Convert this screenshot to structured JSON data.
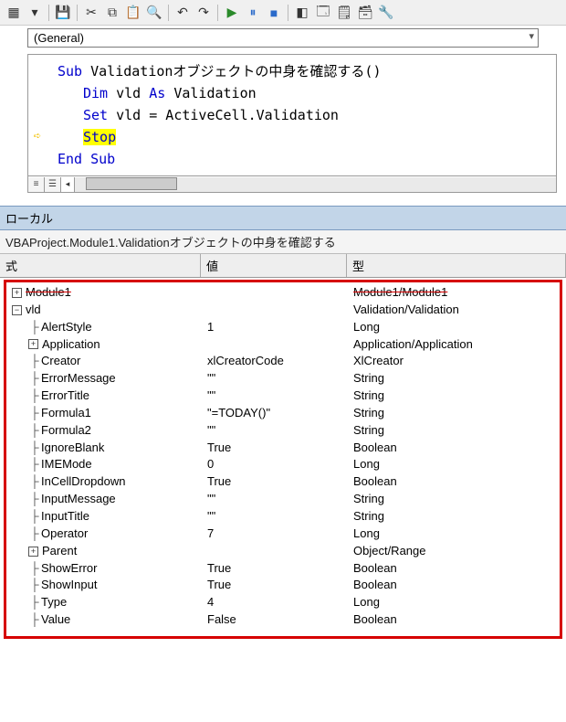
{
  "dropdown": {
    "value": "(General)"
  },
  "code": {
    "line1_prefix": "Sub",
    "line1_name": " Validationオブジェクトの中身を確認する()",
    "line2_dim": "Dim",
    "line2_var": " vld ",
    "line2_as": "As",
    "line2_type": " Validation",
    "line3_set": "Set",
    "line3_rest": " vld = ActiveCell.Validation",
    "line4_stop": "Stop",
    "line5": "End Sub"
  },
  "locals": {
    "title": "ローカル",
    "context": "VBAProject.Module1.Validationオブジェクトの中身を確認する",
    "headers": {
      "expr": "式",
      "val": "値",
      "type": "型"
    },
    "root1": {
      "name": "Module1",
      "type": "Module1/Module1"
    },
    "root2": {
      "name": "vld",
      "type": "Validation/Validation"
    },
    "props": [
      {
        "name": "AlertStyle",
        "val": "1",
        "type": "Long",
        "icon": "leaf"
      },
      {
        "name": "Application",
        "val": "",
        "type": "Application/Application",
        "icon": "plus"
      },
      {
        "name": "Creator",
        "val": "xlCreatorCode",
        "type": "XlCreator",
        "icon": "leaf"
      },
      {
        "name": "ErrorMessage",
        "val": "\"\"",
        "type": "String",
        "icon": "leaf"
      },
      {
        "name": "ErrorTitle",
        "val": "\"\"",
        "type": "String",
        "icon": "leaf"
      },
      {
        "name": "Formula1",
        "val": "\"=TODAY()\"",
        "type": "String",
        "icon": "leaf"
      },
      {
        "name": "Formula2",
        "val": "\"\"",
        "type": "String",
        "icon": "leaf"
      },
      {
        "name": "IgnoreBlank",
        "val": "True",
        "type": "Boolean",
        "icon": "leaf"
      },
      {
        "name": "IMEMode",
        "val": "0",
        "type": "Long",
        "icon": "leaf"
      },
      {
        "name": "InCellDropdown",
        "val": "True",
        "type": "Boolean",
        "icon": "leaf"
      },
      {
        "name": "InputMessage",
        "val": "\"\"",
        "type": "String",
        "icon": "leaf"
      },
      {
        "name": "InputTitle",
        "val": "\"\"",
        "type": "String",
        "icon": "leaf"
      },
      {
        "name": "Operator",
        "val": "7",
        "type": "Long",
        "icon": "leaf"
      },
      {
        "name": "Parent",
        "val": "",
        "type": "Object/Range",
        "icon": "plus"
      },
      {
        "name": "ShowError",
        "val": "True",
        "type": "Boolean",
        "icon": "leaf"
      },
      {
        "name": "ShowInput",
        "val": "True",
        "type": "Boolean",
        "icon": "leaf"
      },
      {
        "name": "Type",
        "val": "4",
        "type": "Long",
        "icon": "leaf"
      },
      {
        "name": "Value",
        "val": "False",
        "type": "Boolean",
        "icon": "leaf"
      }
    ]
  }
}
